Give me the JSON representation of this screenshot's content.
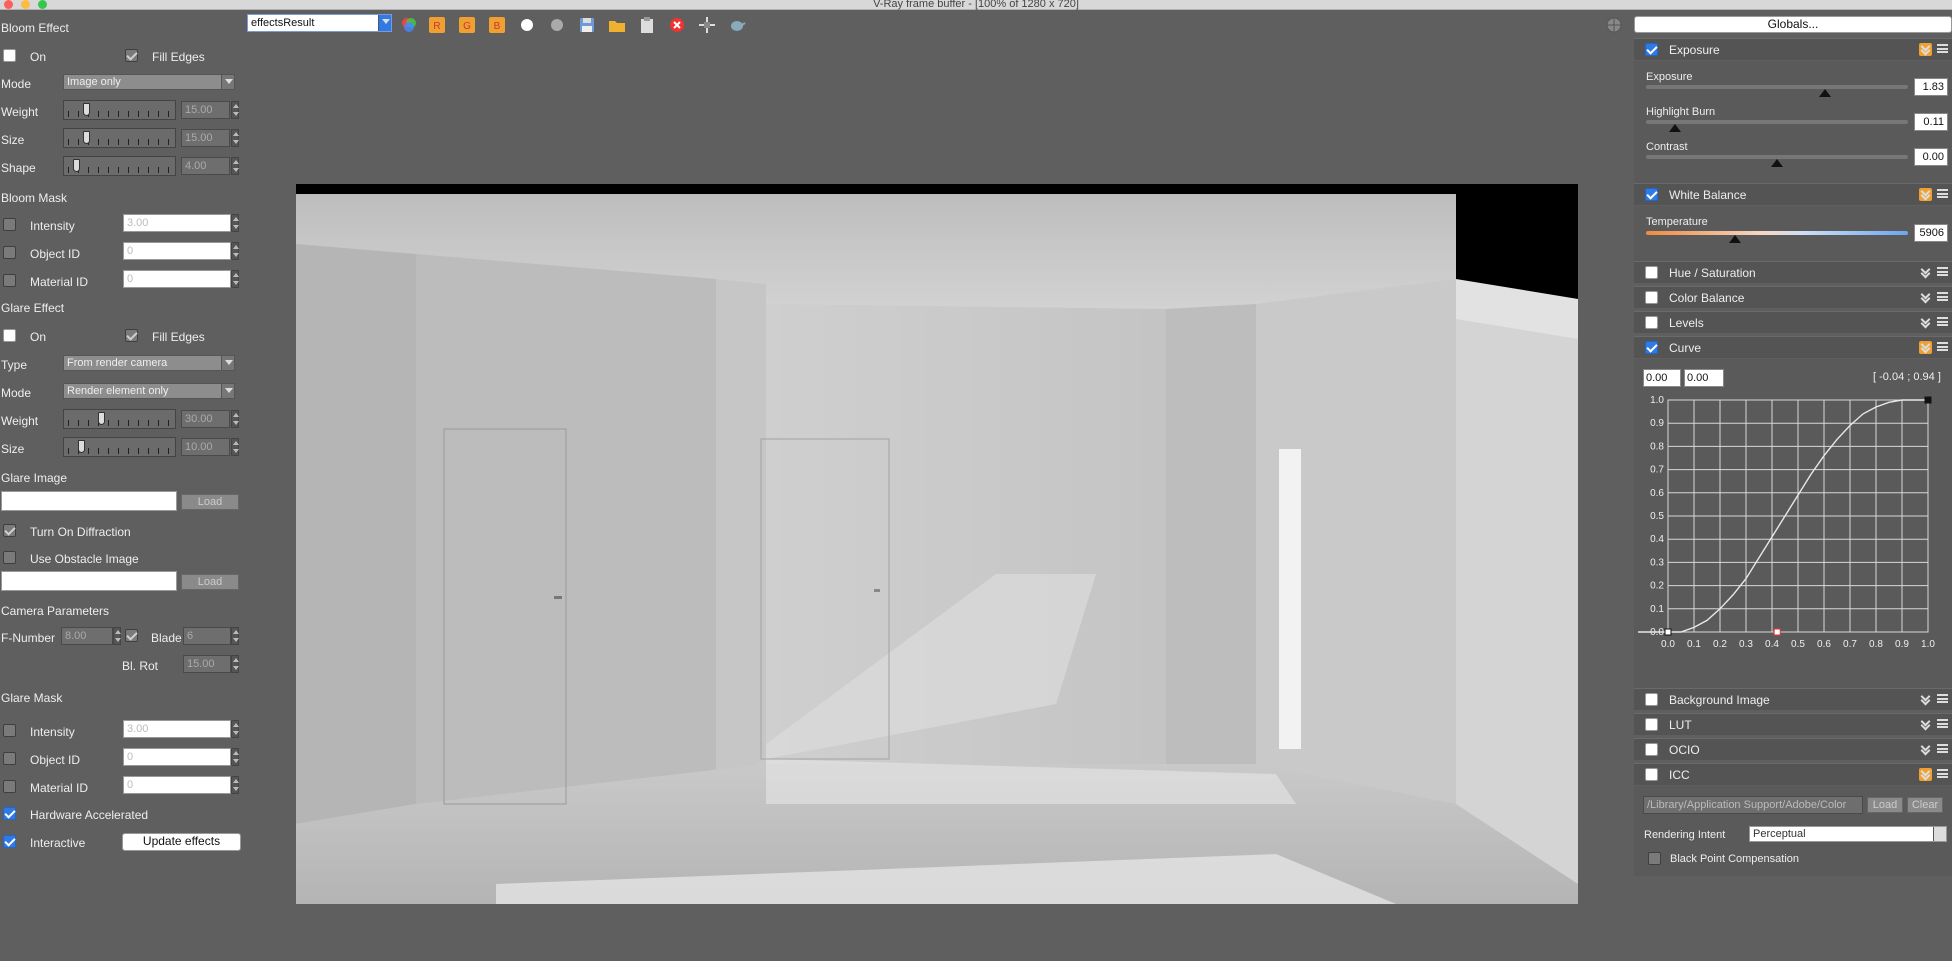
{
  "window": {
    "title": "V-Ray frame buffer - [100% of 1280 x 720]"
  },
  "colors": {
    "accent": "#2f7ae5",
    "orange": "#f0a030",
    "panel": "#5f5f5f"
  },
  "toolbar": {
    "channel": "effectsResult"
  },
  "left": {
    "bloom_effect": "Bloom Effect",
    "on": "On",
    "fill_edges": "Fill Edges",
    "mode": "Mode",
    "mode_value": "Image only",
    "weight": "Weight",
    "weight_value": "15.00",
    "size": "Size",
    "size_value": "15.00",
    "shape": "Shape",
    "shape_value": "4.00",
    "bloom_mask": "Bloom Mask",
    "intensity": "Intensity",
    "intensity_value": "3.00",
    "object_id": "Object ID",
    "object_id_value": "0",
    "material_id": "Material ID",
    "material_id_value": "0",
    "glare_effect": "Glare Effect",
    "glare_on": "On",
    "glare_fill_edges": "Fill Edges",
    "type": "Type",
    "type_value": "From render camera",
    "glare_mode": "Mode",
    "glare_mode_value": "Render element only",
    "glare_weight": "Weight",
    "glare_weight_value": "30.00",
    "glare_size": "Size",
    "glare_size_value": "10.00",
    "glare_image": "Glare Image",
    "load": "Load",
    "turn_on_diffraction": "Turn On Diffraction",
    "use_obstacle_image": "Use Obstacle Image",
    "load2": "Load",
    "camera_parameters": "Camera Parameters",
    "f_number": "F-Number",
    "f_number_value": "8.00",
    "blade": "Blade",
    "blade_value": "6",
    "bl_rot": "Bl. Rot",
    "bl_rot_value": "15.00",
    "glare_mask": "Glare Mask",
    "gm_intensity": "Intensity",
    "gm_intensity_value": "3.00",
    "gm_object_id": "Object ID",
    "gm_object_id_value": "0",
    "gm_material_id": "Material ID",
    "gm_material_id_value": "0",
    "hardware_accelerated": "Hardware Accelerated",
    "interactive": "Interactive",
    "update_effects": "Update effects",
    "levels": {
      "bloom_weight": 0.15,
      "bloom_size": 0.15,
      "bloom_shape": 0.05,
      "glare_weight": 0.3,
      "glare_size": 0.1
    }
  },
  "right": {
    "globals": "Globals...",
    "exposure": {
      "header": "Exposure",
      "exposure_label": "Exposure",
      "exposure_value": "1.83",
      "highlight_burn_label": "Highlight Burn",
      "highlight_burn_value": "0.11",
      "contrast_label": "Contrast",
      "contrast_value": "0.00"
    },
    "white_balance": {
      "header": "White Balance",
      "temperature_label": "Temperature",
      "temperature_value": "5906"
    },
    "hue_saturation": "Hue / Saturation",
    "color_balance": "Color Balance",
    "levels": "Levels",
    "curve": {
      "header": "Curve",
      "in": "0.00",
      "out": "0.00",
      "readout": "[ -0.04 ; 0.94 ]"
    },
    "background_image": "Background Image",
    "lut": "LUT",
    "ocio": "OCIO",
    "icc": {
      "header": "ICC",
      "path": "/Library/Application Support/Adobe/Color",
      "load": "Load",
      "clear": "Clear",
      "rendering_intent": "Rendering Intent",
      "rendering_intent_value": "Perceptual",
      "black_point_compensation": "Black Point Compensation"
    }
  },
  "chart_data": {
    "type": "line",
    "x_ticks": [
      "0.0",
      "0.1",
      "0.2",
      "0.3",
      "0.4",
      "0.5",
      "0.6",
      "0.7",
      "0.8",
      "0.9",
      "1.0"
    ],
    "y_ticks": [
      "0.0",
      "0.1",
      "0.2",
      "0.3",
      "0.4",
      "0.5",
      "0.6",
      "0.7",
      "0.8",
      "0.9",
      "1.0"
    ],
    "xlim": [
      0,
      1
    ],
    "ylim": [
      0,
      1
    ],
    "series": [
      {
        "x": [
          0.0,
          0.05,
          0.1,
          0.15,
          0.2,
          0.25,
          0.3,
          0.35,
          0.4,
          0.45,
          0.5,
          0.55,
          0.6,
          0.65,
          0.7,
          0.75,
          0.8,
          0.85,
          0.9,
          0.95,
          1.0
        ],
        "y": [
          0.0,
          0.0,
          0.02,
          0.05,
          0.1,
          0.16,
          0.23,
          0.32,
          0.41,
          0.5,
          0.59,
          0.68,
          0.76,
          0.83,
          0.89,
          0.94,
          0.97,
          0.99,
          1.0,
          1.0,
          1.0
        ]
      }
    ],
    "control_points": [
      {
        "x": 0.0,
        "y": 0.0
      },
      {
        "x": 0.42,
        "y": 0.0
      },
      {
        "x": 1.0,
        "y": 1.0
      }
    ],
    "grid": true
  }
}
